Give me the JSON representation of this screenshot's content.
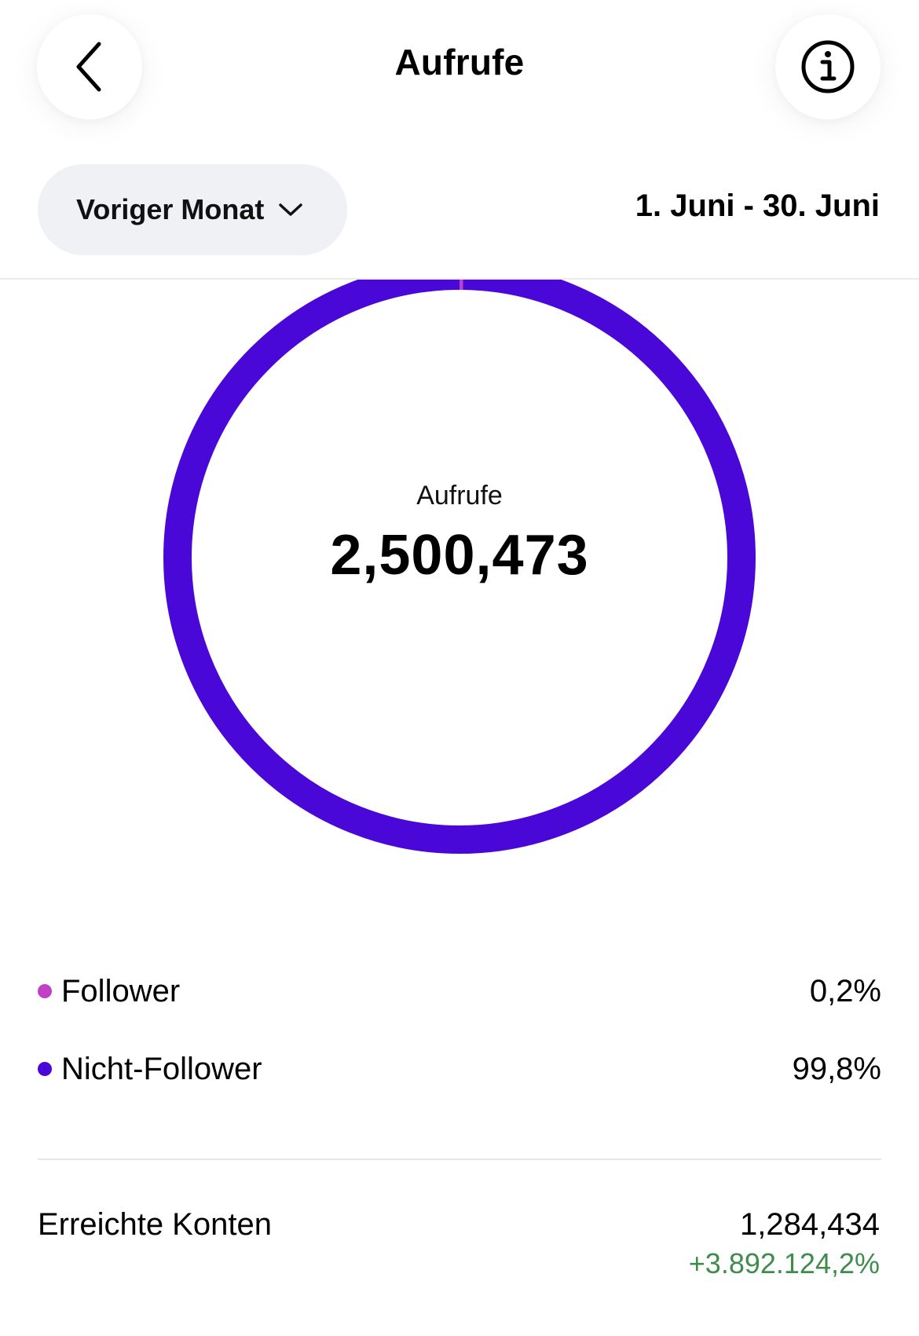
{
  "header": {
    "title": "Aufrufe",
    "back_icon": "chevron-left-icon",
    "info_icon": "info-icon"
  },
  "filter": {
    "period_label": "Voriger Monat",
    "date_range": "1. Juni - 30. Juni"
  },
  "donut": {
    "label": "Aufrufe",
    "total": "2,500,473",
    "segments": [
      {
        "name": "Follower",
        "fraction": 0.002,
        "color": "#c13fc7"
      },
      {
        "name": "Nicht-Follower",
        "fraction": 0.998,
        "color": "#4a08d8"
      }
    ]
  },
  "legend": [
    {
      "label": "Follower",
      "value": "0,2%",
      "color": "#c13fc7"
    },
    {
      "label": "Nicht-Follower",
      "value": "99,8%",
      "color": "#4a08d8"
    }
  ],
  "reach": {
    "label": "Erreichte Konten",
    "value": "1,284,434",
    "change": "+3.892.124,2%",
    "change_color": "#3f8c4d"
  }
}
